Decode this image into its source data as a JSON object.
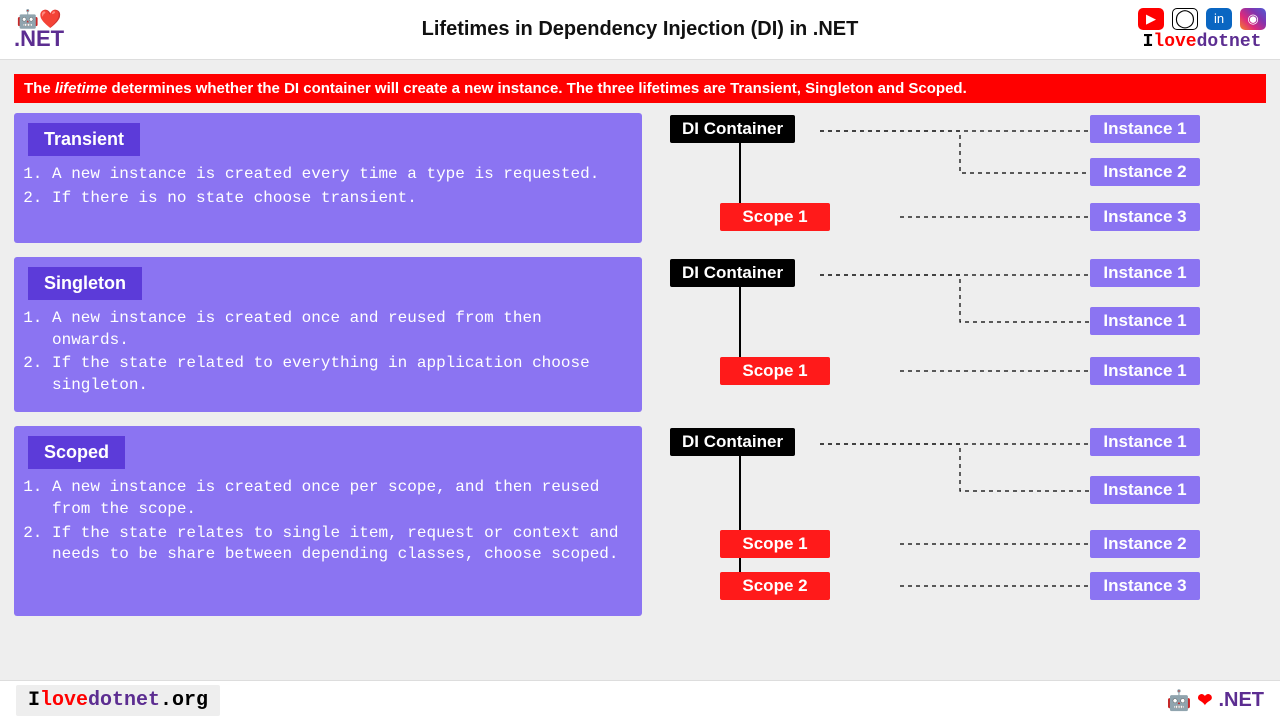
{
  "header": {
    "title": "Lifetimes in Dependency Injection (DI) in .NET",
    "brand_i": "I",
    "brand_love": "love",
    "brand_dotnet": "dotnet",
    "social": {
      "youtube": "youtube-icon",
      "github": "github-icon",
      "linkedin": "linkedin-icon",
      "instagram": "instagram-icon"
    }
  },
  "intro_prefix": "The ",
  "intro_em": "lifetime",
  "intro_rest": " determines whether the DI container will create a new instance. The three lifetimes are Transient, Singleton and Scoped.",
  "sections": [
    {
      "title": "Transient",
      "points": [
        "A new instance is created every time a type is requested.",
        "If there is no state choose transient."
      ],
      "diagram": {
        "container": "DI Container",
        "scopes": [
          "Scope 1"
        ],
        "instances": [
          "Instance 1",
          "Instance 2",
          "Instance 3"
        ]
      }
    },
    {
      "title": "Singleton",
      "points": [
        "A new instance is created once and reused from then onwards.",
        "If the state related to everything in application choose singleton."
      ],
      "diagram": {
        "container": "DI Container",
        "scopes": [
          "Scope 1"
        ],
        "instances": [
          "Instance 1",
          "Instance 1",
          "Instance 1"
        ]
      }
    },
    {
      "title": "Scoped",
      "points": [
        "A new instance is created once per scope, and then reused from the scope.",
        "If the state relates to single item, request or context and needs to be share between depending classes, choose scoped."
      ],
      "diagram": {
        "container": "DI Container",
        "scopes": [
          "Scope 1",
          "Scope 2"
        ],
        "instances": [
          "Instance 1",
          "Instance 1",
          "Instance 2",
          "Instance 3"
        ]
      }
    }
  ],
  "footer": {
    "brand_i": "I",
    "brand_love": "love",
    "brand_dotnet": "dotnet",
    "brand_org": ".org",
    "dotnet_label": ".NET"
  }
}
